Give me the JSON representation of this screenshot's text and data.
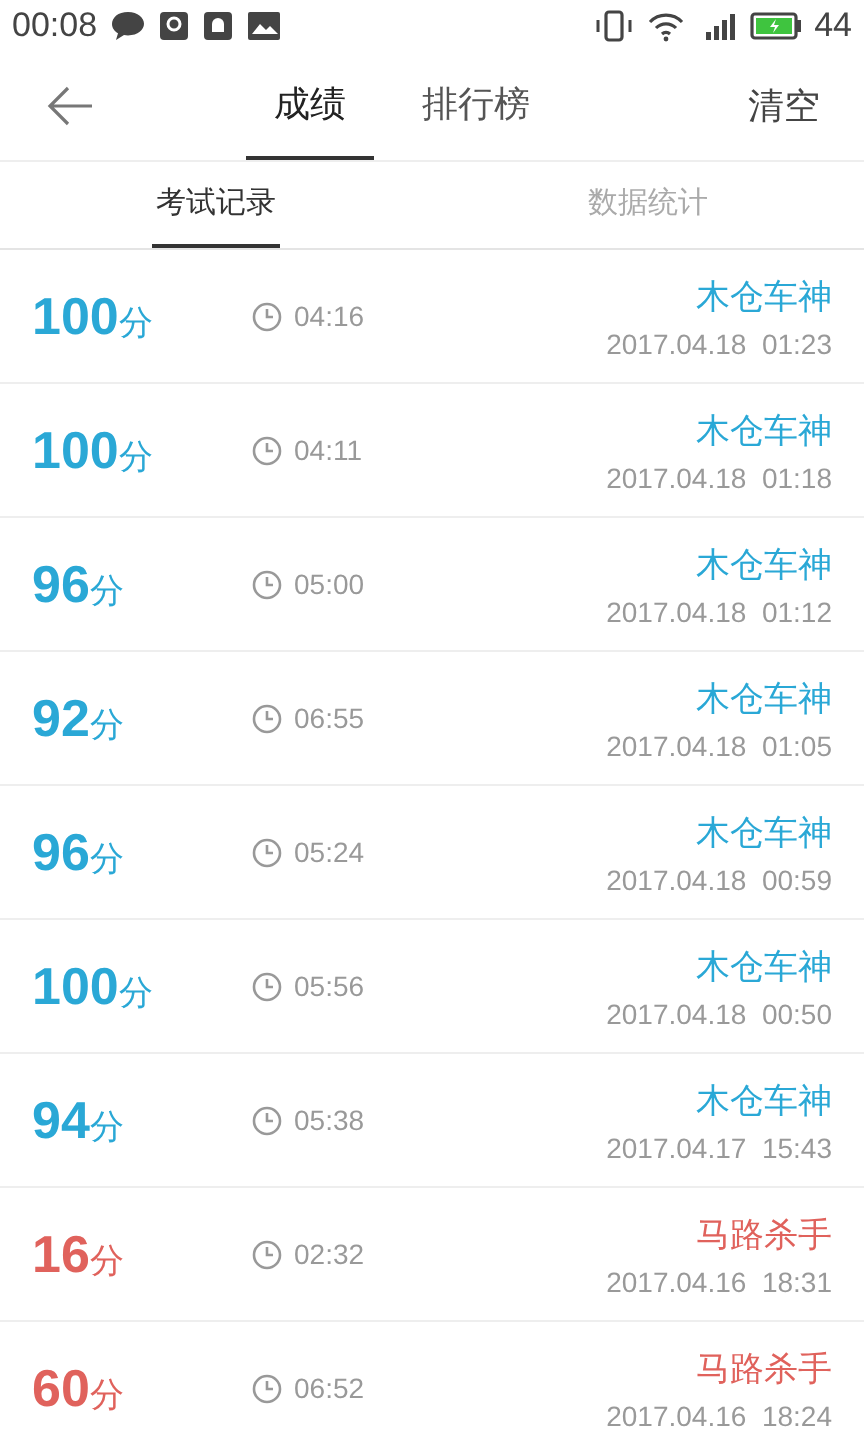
{
  "status_bar": {
    "time": "00:08",
    "battery": "44"
  },
  "header": {
    "tabs": [
      {
        "label": "成绩",
        "selected": true
      },
      {
        "label": "排行榜",
        "selected": false
      }
    ],
    "action": "清空"
  },
  "subtabs": [
    {
      "label": "考试记录",
      "selected": true
    },
    {
      "label": "数据统计",
      "selected": false
    }
  ],
  "records": [
    {
      "score": "100",
      "unit": "分",
      "duration": "04:16",
      "name": "木仓车神",
      "date": "2017.04.18  01:23",
      "color": "#2aa8d6"
    },
    {
      "score": "100",
      "unit": "分",
      "duration": "04:11",
      "name": "木仓车神",
      "date": "2017.04.18  01:18",
      "color": "#2aa8d6"
    },
    {
      "score": "96",
      "unit": "分",
      "duration": "05:00",
      "name": "木仓车神",
      "date": "2017.04.18  01:12",
      "color": "#2aa8d6"
    },
    {
      "score": "92",
      "unit": "分",
      "duration": "06:55",
      "name": "木仓车神",
      "date": "2017.04.18  01:05",
      "color": "#2aa8d6"
    },
    {
      "score": "96",
      "unit": "分",
      "duration": "05:24",
      "name": "木仓车神",
      "date": "2017.04.18  00:59",
      "color": "#2aa8d6"
    },
    {
      "score": "100",
      "unit": "分",
      "duration": "05:56",
      "name": "木仓车神",
      "date": "2017.04.18  00:50",
      "color": "#2aa8d6"
    },
    {
      "score": "94",
      "unit": "分",
      "duration": "05:38",
      "name": "木仓车神",
      "date": "2017.04.17  15:43",
      "color": "#2aa8d6"
    },
    {
      "score": "16",
      "unit": "分",
      "duration": "02:32",
      "name": "马路杀手",
      "date": "2017.04.16  18:31",
      "color": "#e0625c"
    },
    {
      "score": "60",
      "unit": "分",
      "duration": "06:52",
      "name": "马路杀手",
      "date": "2017.04.16  18:24",
      "color": "#e0625c"
    }
  ]
}
